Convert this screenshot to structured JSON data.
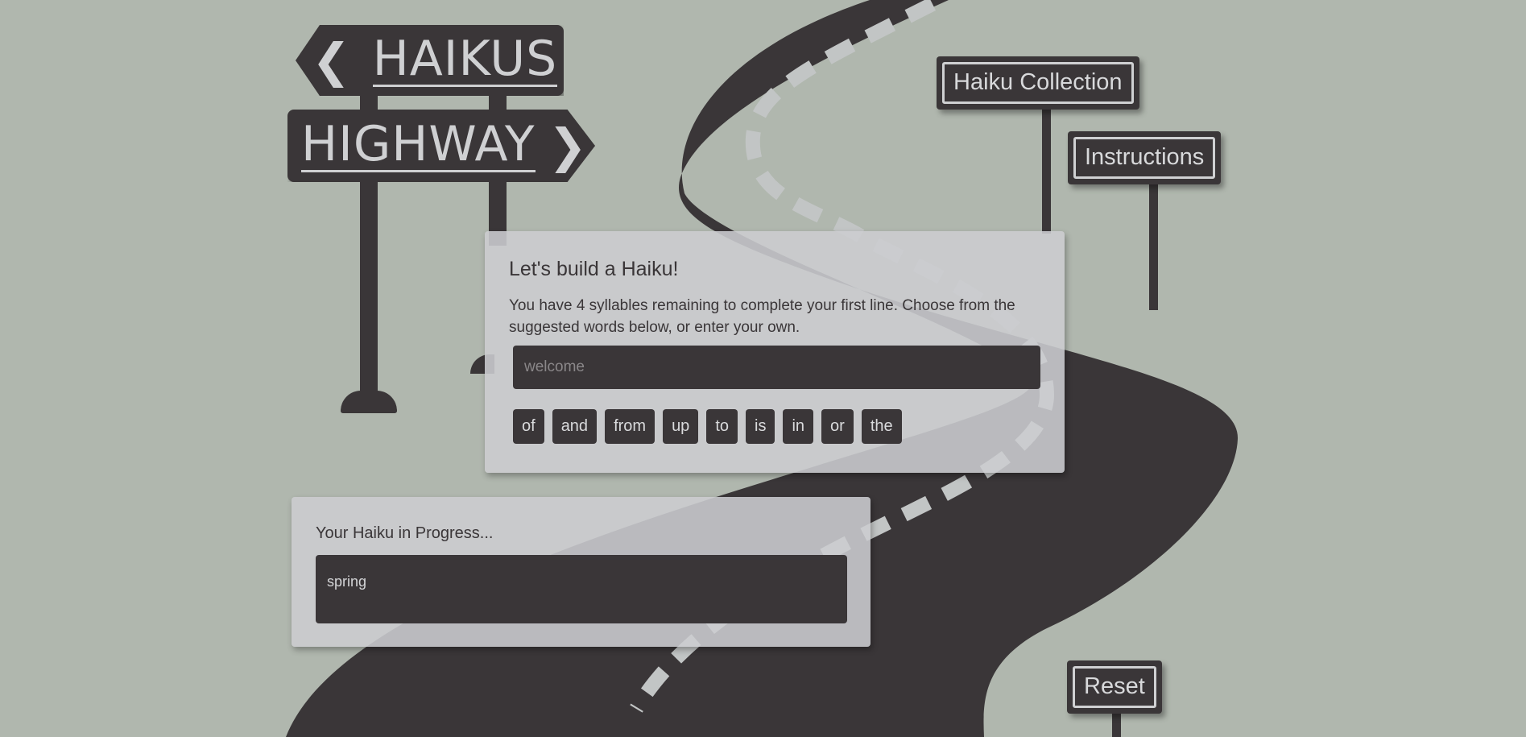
{
  "title_sign": {
    "line1": "HAIKUS",
    "line2": "HIGHWAY"
  },
  "nav": {
    "collection_label": "Haiku Collection",
    "instructions_label": "Instructions",
    "reset_label": "Reset"
  },
  "builder": {
    "heading": "Let's build a Haiku!",
    "message": "You have 4 syllables remaining to complete your first line. Choose from the suggested words below, or enter your own.",
    "input_placeholder": "welcome",
    "suggestions": [
      "of",
      "and",
      "from",
      "up",
      "to",
      "is",
      "in",
      "or",
      "the"
    ]
  },
  "progress": {
    "heading": "Your Haiku in Progress...",
    "text": "spring"
  },
  "colors": {
    "background": "#b0b7ae",
    "road": "#3a3638",
    "road_lines": "#c2c5c5",
    "sign_text": "#cfd0d2",
    "panel": "#cccdd0"
  }
}
